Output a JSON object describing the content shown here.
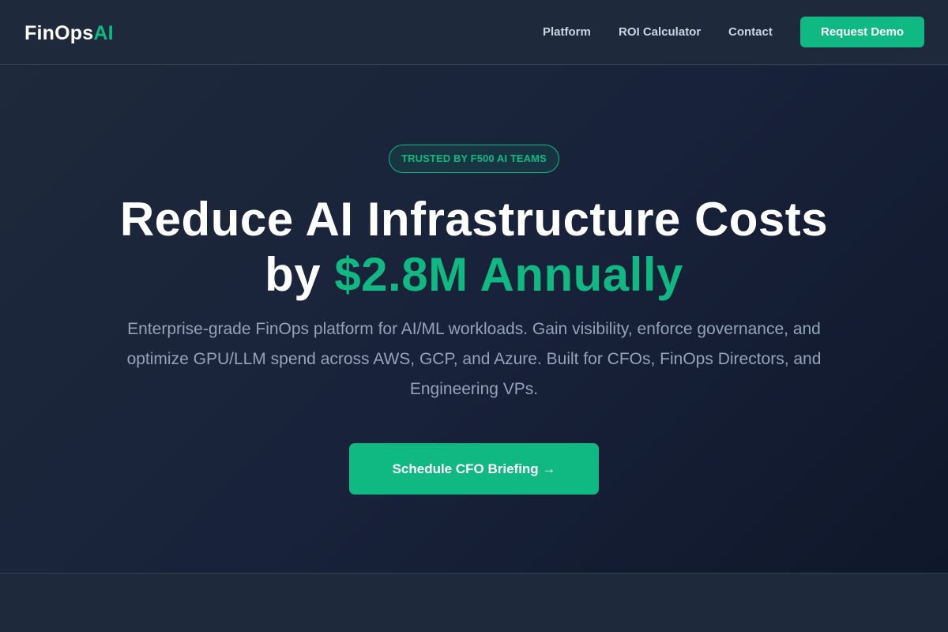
{
  "navbar": {
    "logo_main": "FinOps",
    "logo_accent": "AI",
    "links": [
      "Platform",
      "ROI Calculator",
      "Contact"
    ],
    "cta_label": "Request Demo"
  },
  "hero": {
    "badge": "TRUSTED BY F500 AI TEAMS",
    "headline_line1": "Reduce AI Infrastructure Costs",
    "headline_prefix": "by ",
    "headline_accent": "$2.8M Annually",
    "subtext": "Enterprise-grade FinOps platform for AI/ML workloads. Gain visibility, enforce governance, and optimize GPU/LLM spend across AWS, GCP, and Azure. Built for CFOs, FinOps Directors, and Engineering VPs.",
    "cta_label": "Schedule CFO Briefing →"
  },
  "colors": {
    "background": "#1e293b",
    "accent": "#10b981",
    "text_primary": "#ffffff",
    "text_muted": "#94a3b8"
  }
}
